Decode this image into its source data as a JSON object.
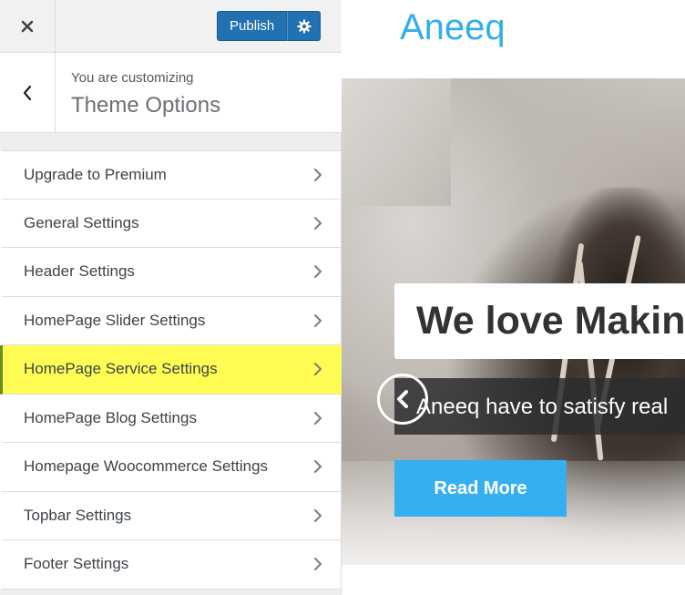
{
  "header": {
    "close_icon": "close-icon",
    "publish_label": "Publish",
    "settings_icon": "gear-icon"
  },
  "info": {
    "customizing_label": "You are customizing",
    "panel_title": "Theme Options"
  },
  "menu": {
    "items": [
      {
        "label": "Upgrade to Premium"
      },
      {
        "label": "General Settings"
      },
      {
        "label": "Header Settings"
      },
      {
        "label": "HomePage Slider Settings"
      },
      {
        "label": "HomePage Service Settings",
        "highlighted": true
      },
      {
        "label": "HomePage Blog Settings"
      },
      {
        "label": "Homepage Woocommerce Settings"
      },
      {
        "label": "Topbar Settings"
      },
      {
        "label": "Footer Settings"
      }
    ]
  },
  "preview": {
    "site_title": "Aneeq",
    "slide_heading": "We love Makin",
    "slide_text": "Aneeq have to satisfy real",
    "read_more_label": "Read More"
  },
  "colors": {
    "publish": "#2271b1",
    "highlight": "#fffd54",
    "brand": "#34aee8",
    "button": "#35aff0"
  }
}
